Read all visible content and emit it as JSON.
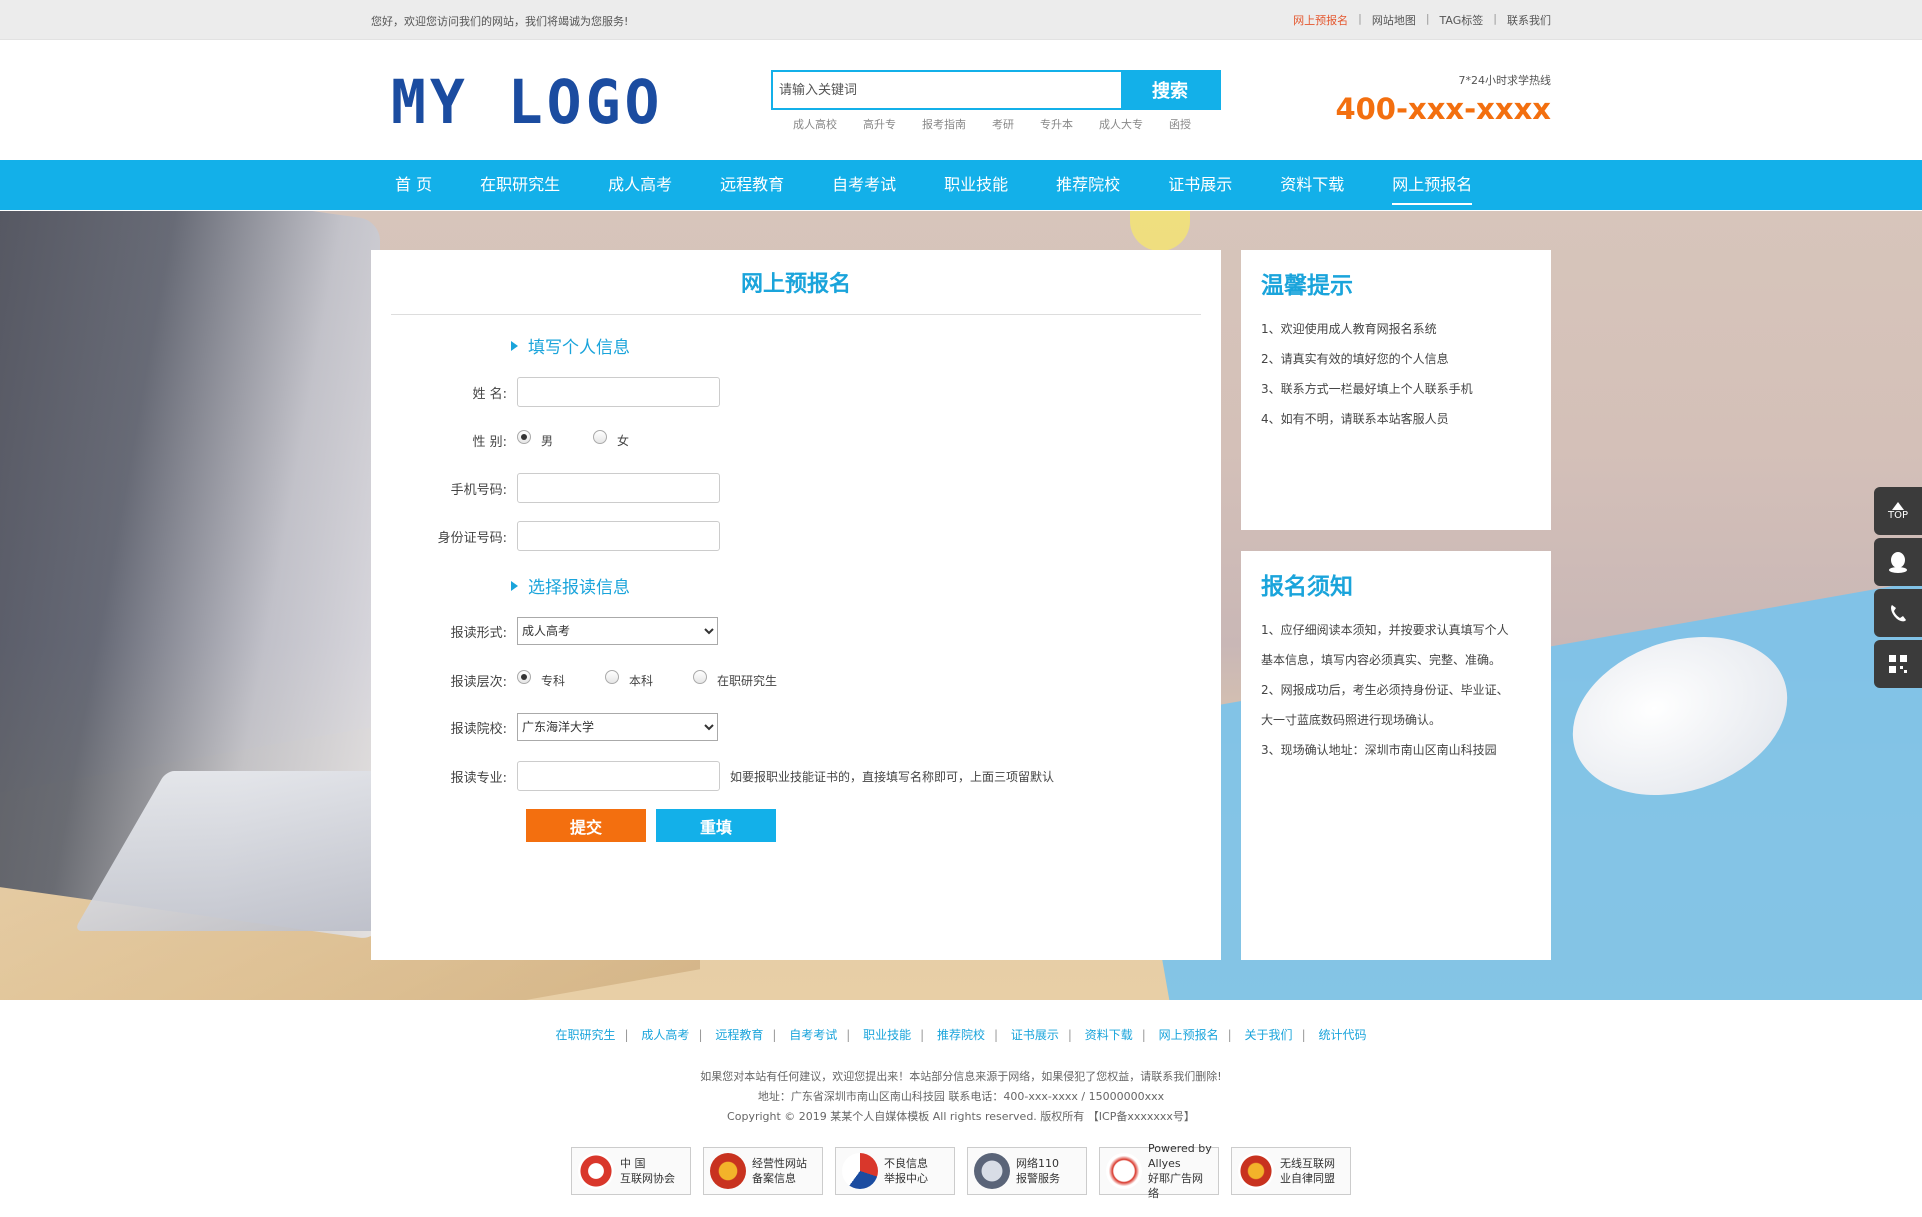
{
  "topbar": {
    "welcome": "您好，欢迎您访问我们的网站，我们将竭诚为您服务!",
    "links": [
      "网上预报名",
      "网站地图",
      "TAG标签",
      "联系我们"
    ]
  },
  "header": {
    "logo": "MY LOGO",
    "search_placeholder": "请输入关键词",
    "search_button": "搜索",
    "hotwords": [
      "成人高校",
      "高升专",
      "报考指南",
      "考研",
      "专升本",
      "成人大专",
      "函授"
    ],
    "hotline_label": "7*24小时求学热线",
    "hotline_number": "400-xxx-xxxx"
  },
  "nav": [
    "首 页",
    "在职研究生",
    "成人高考",
    "远程教育",
    "自考考试",
    "职业技能",
    "推荐院校",
    "证书展示",
    "资料下载",
    "网上预报名"
  ],
  "form": {
    "title": "网上预报名",
    "section1": "填写个人信息",
    "name_label": "姓  名:",
    "gender_label": "性  别:",
    "gender_options": [
      "男",
      "女"
    ],
    "phone_label": "手机号码:",
    "id_label": "身份证号码:",
    "section2": "选择报读信息",
    "mode_label": "报读形式:",
    "mode_value": "成人高考",
    "level_label": "报读层次:",
    "level_options": [
      "专科",
      "本科",
      "在职研究生"
    ],
    "school_label": "报读院校:",
    "school_value": "广东海洋大学",
    "major_label": "报读专业:",
    "major_hint": "如要报职业技能证书的，直接填写名称即可，上面三项留默认",
    "submit": "提交",
    "reset": "重填"
  },
  "tips": {
    "title": "温馨提示",
    "items": [
      "1、欢迎使用成人教育网报名系统",
      "2、请真实有效的填好您的个人信息",
      "3、联系方式一栏最好填上个人联系手机",
      "4、如有不明，请联系本站客服人员"
    ]
  },
  "notice": {
    "title": "报名须知",
    "items": [
      "1、应仔细阅读本须知，并按要求认真填写个人",
      "基本信息，填写内容必须真实、完整、准确。",
      "2、网报成功后，考生必须持身份证、毕业证、",
      "大一寸蓝底数码照进行现场确认。",
      "3、现场确认地址：深圳市南山区南山科技园"
    ]
  },
  "floatbar": {
    "top_label": "TOP"
  },
  "footer": {
    "links": [
      "在职研究生",
      "成人高考",
      "远程教育",
      "自考考试",
      "职业技能",
      "推荐院校",
      "证书展示",
      "资料下载",
      "网上预报名",
      "关于我们",
      "统计代码"
    ],
    "line1": "如果您对本站有任何建议，欢迎您提出来！本站部分信息来源于网络，如果侵犯了您权益，请联系我们删除!",
    "line2": "地址：广东省深圳市南山区南山科技园   联系电话：400-xxx-xxxx / 15000000xxx",
    "line3": "Copyright © 2019 某某个人自媒体模板 All rights reserved. 版权所有 【ICP备xxxxxxx号】",
    "badges": [
      {
        "l1": "中  国",
        "l2": "互联网协会"
      },
      {
        "l1": "经营性网站",
        "l2": "备案信息"
      },
      {
        "l1": "不良信息",
        "l2": "举报中心"
      },
      {
        "l1": "网络110",
        "l2": "报警服务"
      },
      {
        "l1": "Powered by Allyes",
        "l2": "好耶广告网络"
      },
      {
        "l1": "无线互联网",
        "l2": "业自律同盟"
      }
    ]
  },
  "colors": {
    "brand": "#13b0e9",
    "accent": "#f36f0f",
    "logo": "#1b4ca0"
  }
}
